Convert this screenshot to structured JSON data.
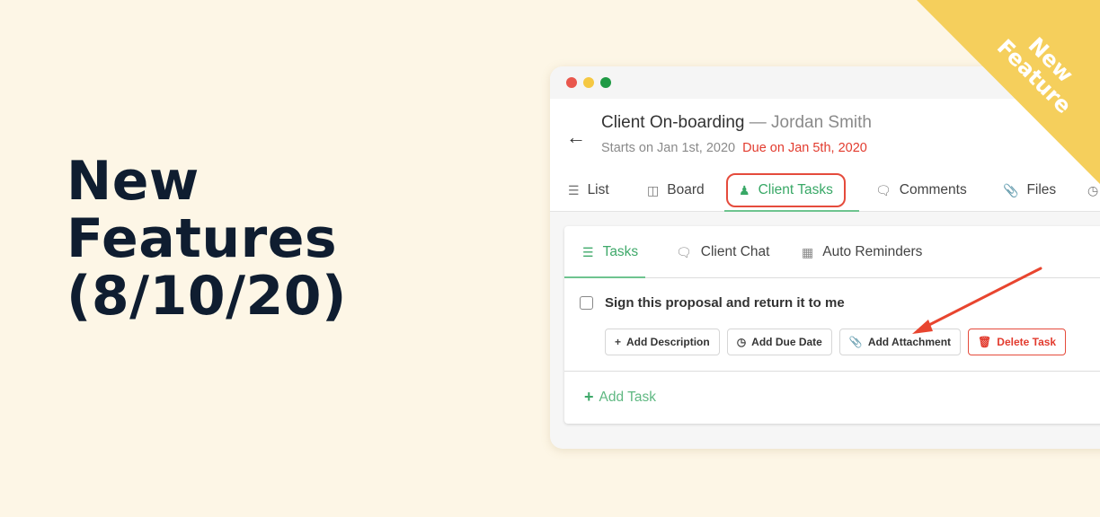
{
  "headline": {
    "lines": [
      "New",
      "Features",
      "(8/10/20)"
    ]
  },
  "ribbon": {
    "lines": [
      "New",
      "Feature"
    ],
    "color": "#f5cf5c"
  },
  "window": {
    "controls": [
      "close",
      "minimize",
      "maximize"
    ],
    "header": {
      "title": "Client On-boarding",
      "separator": "—",
      "client_name": "Jordan Smith",
      "start_text": "Starts on Jan 1st, 2020",
      "due_text": "Due on Jan 5th, 2020"
    },
    "nav_tabs": [
      {
        "label": "List",
        "icon": "list-icon"
      },
      {
        "label": "Board",
        "icon": "board-icon"
      },
      {
        "label": "Client Tasks",
        "icon": "user-icon",
        "active": true
      },
      {
        "label": "Comments",
        "icon": "comments-icon"
      },
      {
        "label": "Files",
        "icon": "paperclip-icon"
      },
      {
        "label": "",
        "icon": "clock-icon"
      }
    ],
    "sub_tabs": [
      {
        "label": "Tasks",
        "icon": "list-icon",
        "active": true
      },
      {
        "label": "Client Chat",
        "icon": "chat-bubble-icon"
      },
      {
        "label": "Auto Reminders",
        "icon": "calendar-icon"
      }
    ],
    "task": {
      "title": "Sign this proposal and return it to me",
      "checked": false,
      "actions": [
        {
          "label": "Add Description",
          "icon": "plus-icon"
        },
        {
          "label": "Add Due Date",
          "icon": "clock-icon"
        },
        {
          "label": "Add Attachment",
          "icon": "paperclip-icon"
        },
        {
          "label": "Delete Task",
          "icon": "trash-icon",
          "danger": true
        }
      ]
    },
    "add_task_label": "Add Task"
  },
  "colors": {
    "background": "#fdf6e6",
    "headline": "#0f1d30",
    "accent_green": "#3fa96a",
    "danger_red": "#e23b2e",
    "ribbon_yellow": "#f5cf5c"
  }
}
